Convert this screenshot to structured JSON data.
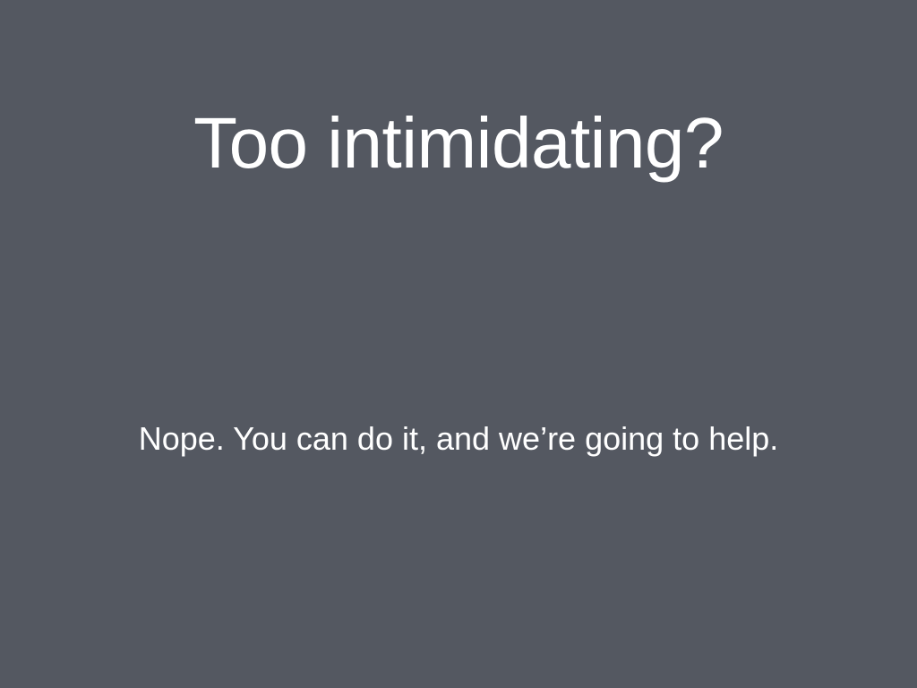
{
  "slide": {
    "background_color": "#545861",
    "text_color": "#ffffff",
    "title": "Too intimidating?",
    "body": "Nope. You can do it, and we’re going to help."
  }
}
